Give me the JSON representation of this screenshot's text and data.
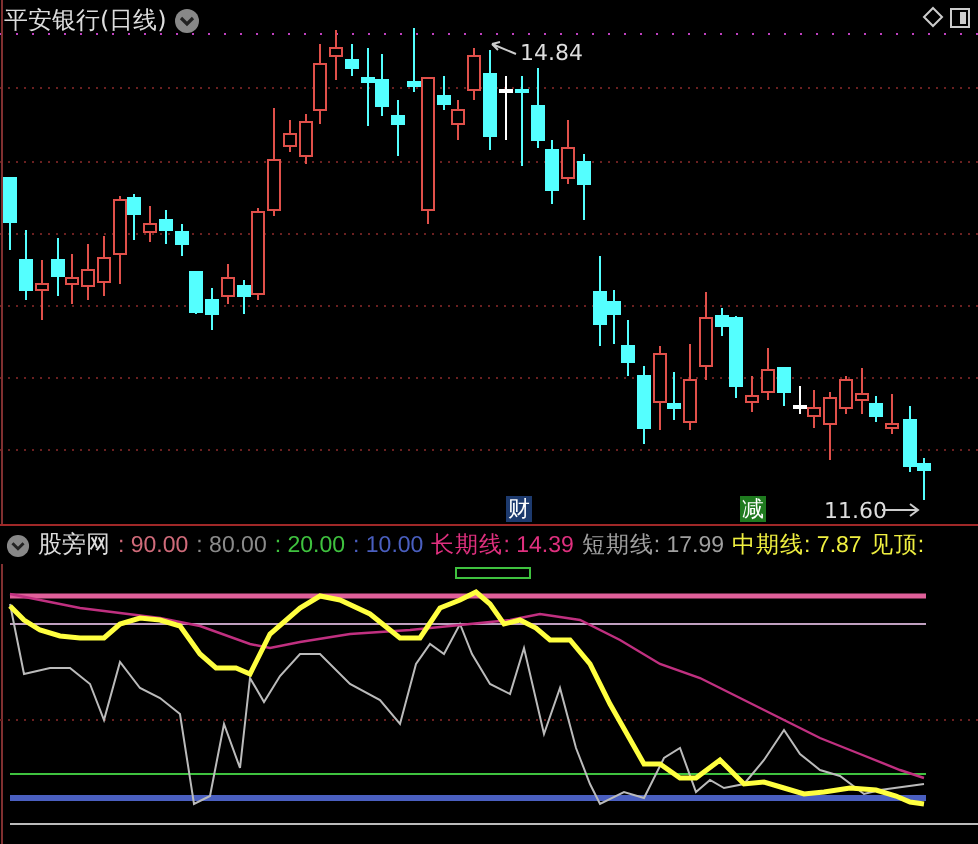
{
  "chart": {
    "title": "平安银行(日线)",
    "high_label": "14.84",
    "low_label": "11.60",
    "markers": [
      {
        "text": "财",
        "color": "#1d3a6e"
      },
      {
        "text": "减",
        "color": "#1f7a1f"
      }
    ]
  },
  "indicator": {
    "name": "股旁网",
    "legend": [
      {
        "text": ": 90.00",
        "color": "#d06b7a"
      },
      {
        "text": ": 80.00",
        "color": "#8a8a8a"
      },
      {
        "text": ": 20.00",
        "color": "#3fc23f"
      },
      {
        "text": ": 10.00",
        "color": "#4a5fc0"
      },
      {
        "text": "长期线: 14.39",
        "color": "#e0307f"
      },
      {
        "text": "短期线: 17.99",
        "color": "#a0a0a0"
      },
      {
        "text": "中期线: 7.87",
        "color": "#f0f040"
      },
      {
        "text": "见顶:",
        "color": "#f0f040"
      }
    ]
  }
}
